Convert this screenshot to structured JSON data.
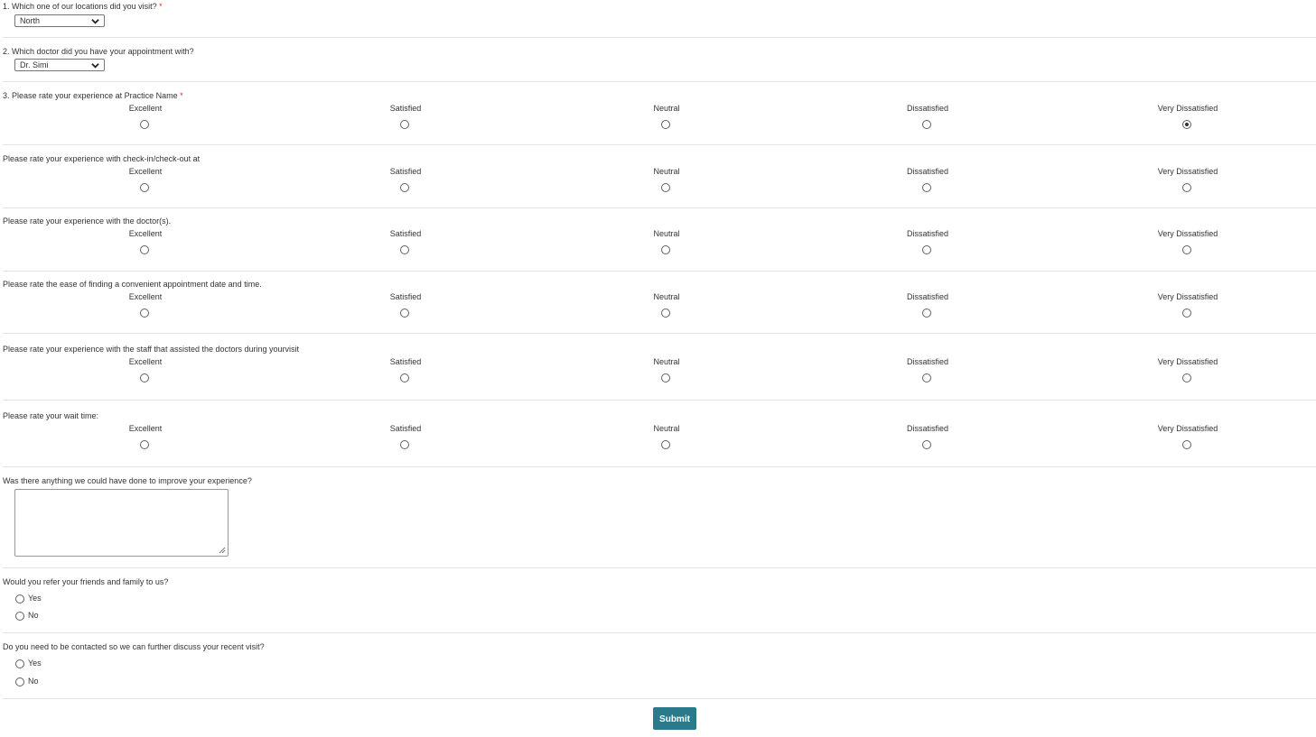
{
  "q1": {
    "label": "1. Which one of our locations did you visit?",
    "required": "*",
    "selected": "North"
  },
  "q2": {
    "label": "2. Which doctor did you have your appointment with?",
    "selected": "Dr. Simi"
  },
  "rating_options": [
    "Excellent",
    "Satisfied",
    "Neutral",
    "Dissatisfied",
    "Very Dissatisfied"
  ],
  "ratings": [
    {
      "label": "3. Please rate your experience at Practice Name",
      "required": "*",
      "selected": "Very Dissatisfied"
    },
    {
      "label": "Please rate your experience with check-in/check-out at",
      "selected": null
    },
    {
      "label": "Please rate your experience with the doctor(s).",
      "selected": null
    },
    {
      "label": "Please rate the ease of finding a convenient appointment date and time.",
      "selected": null
    },
    {
      "label": "Please rate your experience with the staff that assisted the doctors during yourvisit",
      "selected": null
    },
    {
      "label": "Please rate your wait time:",
      "selected": null
    }
  ],
  "improve": {
    "label": "Was there anything we could have done to improve your experience?",
    "value": ""
  },
  "refer": {
    "label": "Would you refer your friends and family to us?",
    "options": [
      "Yes",
      "No"
    ]
  },
  "contact": {
    "label": "Do you need to be contacted so we can further discuss your recent visit?",
    "options": [
      "Yes",
      "No"
    ]
  },
  "submit_label": "Submit",
  "colors": {
    "accent": "#2b7a8c",
    "required": "#c0392b"
  },
  "icons": {
    "dropdown": "chevron-down-icon",
    "resize": "resize-grip-icon"
  }
}
